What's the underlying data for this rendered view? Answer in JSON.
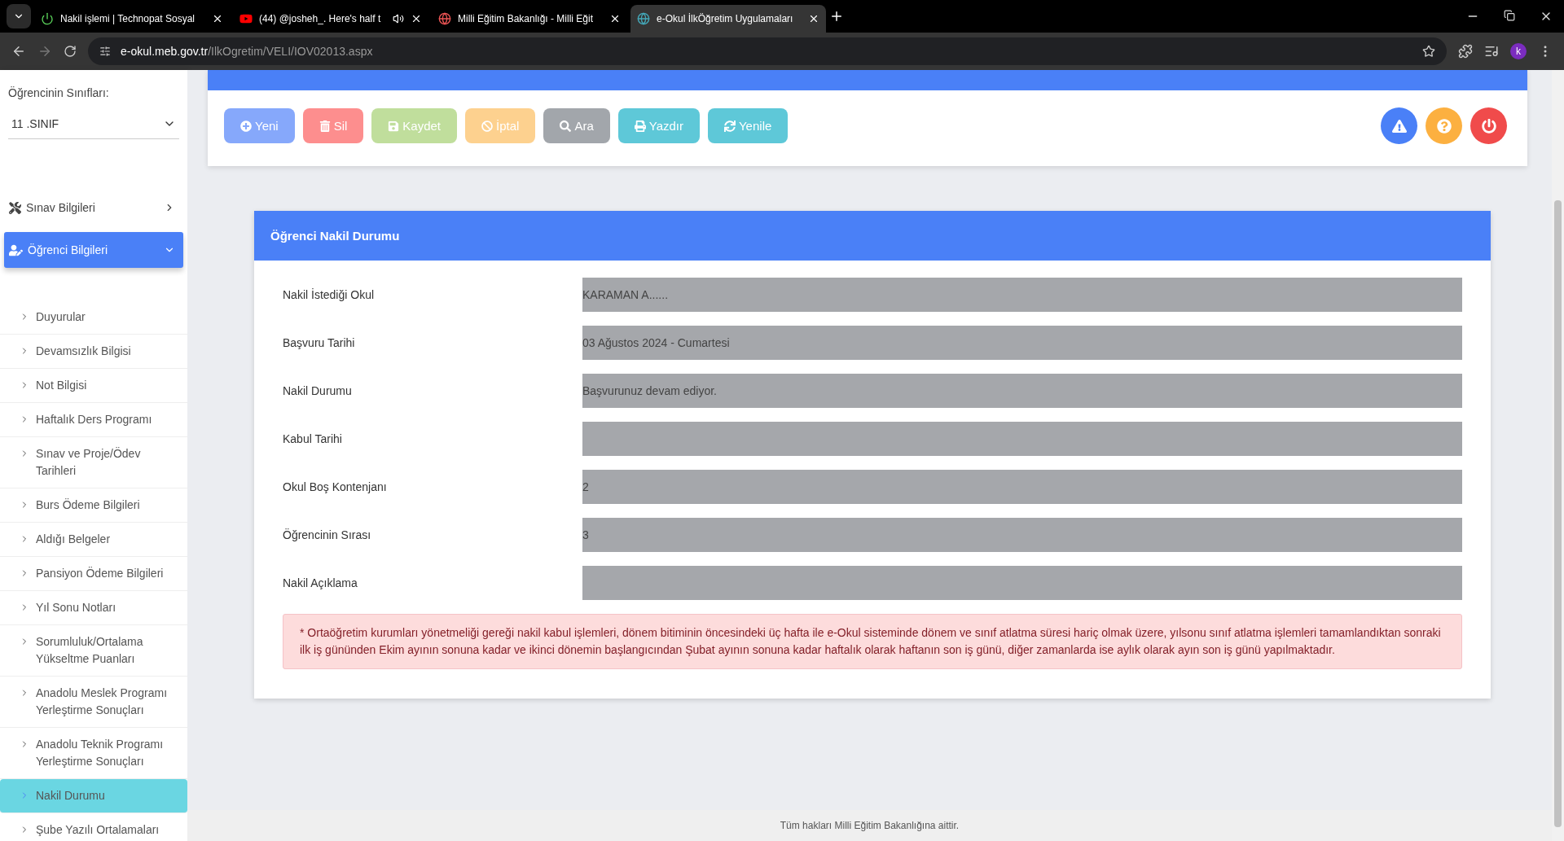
{
  "browser": {
    "tabs": [
      {
        "title": "Nakil işlemi | Technopat Sosyal",
        "kind": "power",
        "selected": false
      },
      {
        "title": "(44) @josheh_. Here's half t",
        "kind": "video",
        "audio": true,
        "selected": false
      },
      {
        "title": "Milli Eğitim Bakanlığı - Milli Eğit",
        "kind": "ministry",
        "selected": false
      },
      {
        "title": "e-Okul İlkÖğretim Uygulamaları",
        "kind": "school",
        "selected": true
      }
    ],
    "url_host": "e-okul.meb.gov.tr",
    "url_path": "/IlkOgretim/VELI/IOV02013.aspx",
    "profile": "k"
  },
  "sidebar": {
    "class_label": "Öğrencinin Sınıfları:",
    "class_value": "11 .SINIF",
    "groups": [
      {
        "label": "Sınav Bilgileri",
        "kind": "tools",
        "expanded": false
      },
      {
        "label": "Öğrenci Bilgileri",
        "kind": "user",
        "expanded": true
      }
    ],
    "items": [
      {
        "label": "Duyurular",
        "selected": false
      },
      {
        "label": "Devamsızlık Bilgisi",
        "selected": false
      },
      {
        "label": "Not Bilgisi",
        "selected": false
      },
      {
        "label": "Haftalık Ders Programı",
        "selected": false
      },
      {
        "label": "Sınav ve Proje/Ödev Tarihleri",
        "selected": false
      },
      {
        "label": "Burs Ödeme Bilgileri",
        "selected": false
      },
      {
        "label": "Aldığı Belgeler",
        "selected": false
      },
      {
        "label": "Pansiyon Ödeme Bilgileri",
        "selected": false
      },
      {
        "label": "Yıl Sonu Notları",
        "selected": false
      },
      {
        "label": "Sorumluluk/Ortalama Yükseltme Puanları",
        "selected": false
      },
      {
        "label": "Anadolu Meslek Programı Yerleştirme Sonuçları",
        "selected": false
      },
      {
        "label": "Anadolu Teknik Programı Yerleştirme Sonuçları",
        "selected": false
      },
      {
        "label": "Nakil Durumu",
        "selected": true
      },
      {
        "label": "Şube Yazılı Ortalamaları",
        "selected": false
      }
    ]
  },
  "toolbar": {
    "buttons": [
      {
        "label": "Yeni",
        "kind": "new",
        "color": "#86a8fb"
      },
      {
        "label": "Sil",
        "kind": "delete",
        "color": "#fd8e8e"
      },
      {
        "label": "Kaydet",
        "kind": "save",
        "color": "#c0de9c"
      },
      {
        "label": "İptal",
        "kind": "cancel",
        "color": "#fdd18f"
      },
      {
        "label": "Ara",
        "kind": "search",
        "color": "#a2a6ab"
      },
      {
        "label": "Yazdır",
        "kind": "print",
        "color": "#5ec8d8"
      },
      {
        "label": "Yenile",
        "kind": "refresh",
        "color": "#5ec8d8"
      }
    ],
    "round_buttons": [
      {
        "kind": "warning",
        "color": "#4a80f7"
      },
      {
        "kind": "help",
        "color": "#fcb040"
      },
      {
        "kind": "power",
        "color": "#f04b4b"
      }
    ]
  },
  "panel": {
    "title": "Öğrenci Nakil Durumu",
    "fields": [
      {
        "label": "Nakil İstediği Okul",
        "value": "KARAMAN A......"
      },
      {
        "label": "Başvuru Tarihi",
        "value": "03 Ağustos 2024 - Cumartesi"
      },
      {
        "label": "Nakil Durumu",
        "value": "Başvurunuz devam ediyor."
      },
      {
        "label": "Kabul Tarihi"
      },
      {
        "label": "Okul Boş Kontenjanı",
        "value": "2"
      },
      {
        "label": "Öğrencinin Sırası",
        "value": "3"
      },
      {
        "label": "Nakil Açıklama"
      }
    ],
    "notice": "* Ortaöğretim kurumları yönetmeliği gereği nakil kabul işlemleri, dönem bitiminin öncesindeki üç hafta ile e-Okul sisteminde dönem ve sınıf atlatma süresi hariç olmak üzere, yılsonu sınıf atlatma işlemleri tamamlandıktan sonraki ilk iş gününden Ekim ayının sonuna kadar ve ikinci dönemin başlangıcından Şubat ayının sonuna kadar haftalık olarak haftanın son iş günü, diğer zamanlarda ise aylık olarak ayın son iş günü yapılmaktadır."
  },
  "footer": "Tüm hakları Milli Eğitim Bakanlığına aittir."
}
